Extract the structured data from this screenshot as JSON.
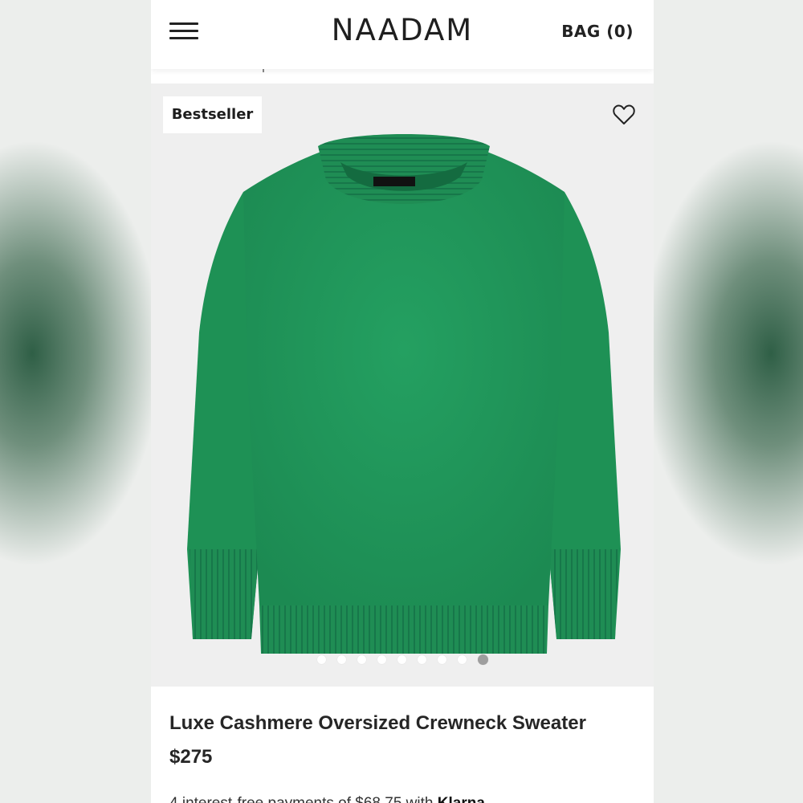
{
  "header": {
    "brand": "NAADAM",
    "bag_label": "BAG (0)"
  },
  "product": {
    "badge": "Bestseller",
    "title": "Luxe Cashmere Oversized Crewneck Sweater",
    "price": "$275",
    "installment_text": "4 interest-free payments of $68.75 with",
    "installment_provider": "Klarna",
    "image_color": "#21945a",
    "gallery": {
      "total_images": 9,
      "active_index": 8
    }
  },
  "colors": {
    "background": "#ffffff",
    "image_bg": "#efefef",
    "text": "#262626",
    "sweater_green": "#21945a"
  },
  "icons": {
    "menu": "hamburger-menu-icon",
    "wishlist": "heart-outline-icon"
  }
}
